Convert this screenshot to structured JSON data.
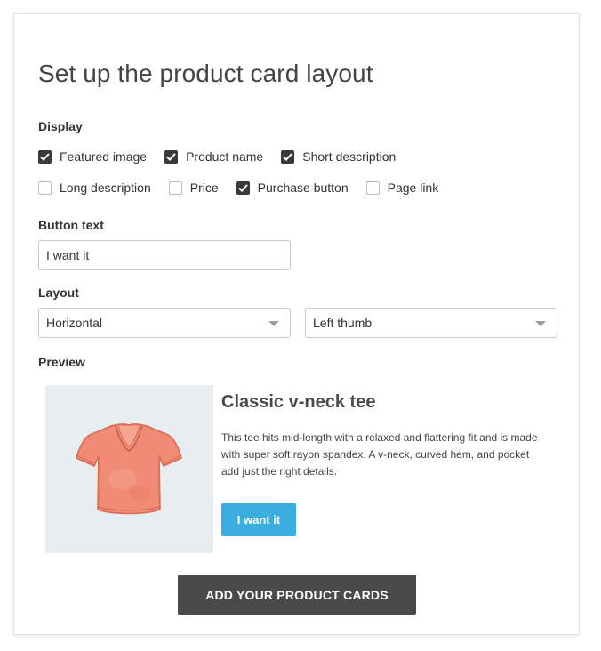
{
  "page_title": "Set up the product card layout",
  "display": {
    "label": "Display",
    "options": [
      {
        "label": "Featured image",
        "checked": true
      },
      {
        "label": "Product name",
        "checked": true
      },
      {
        "label": "Short description",
        "checked": true
      },
      {
        "label": "Long description",
        "checked": false
      },
      {
        "label": "Price",
        "checked": false
      },
      {
        "label": "Purchase button",
        "checked": true
      },
      {
        "label": "Page link",
        "checked": false
      }
    ]
  },
  "button_text": {
    "label": "Button text",
    "value": "I want it"
  },
  "layout": {
    "label": "Layout",
    "orientation": "Horizontal",
    "thumb_position": "Left thumb"
  },
  "preview": {
    "label": "Preview",
    "image_icon": "t-shirt-icon",
    "product_title": "Classic v-neck tee",
    "description": "This tee hits mid-length with a relaxed and flattering fit and is made with super soft rayon spandex. A v-neck, curved hem, and pocket add just the right details.",
    "button_label": "I want it"
  },
  "cta_label": "ADD YOUR PRODUCT CARDS",
  "colors": {
    "accent_blue": "#3aaee0",
    "cta_dark": "#4a4a4a",
    "checkbox_dark": "#3a3a3a",
    "preview_bg": "#e8edf2",
    "shirt": "#f08c76"
  }
}
